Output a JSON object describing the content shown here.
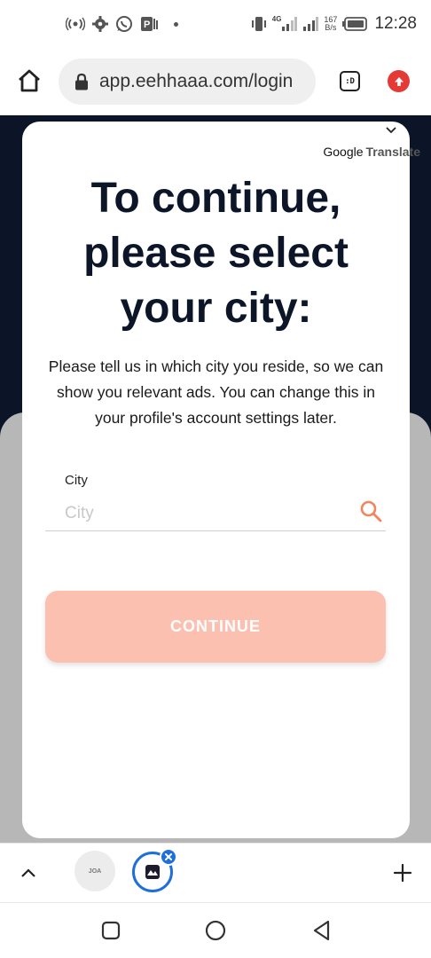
{
  "status_bar": {
    "net_speed_value": "167",
    "net_speed_unit": "B/s",
    "network_type": "4G",
    "time": "12:28"
  },
  "browser": {
    "url": "app.eehhaaa.com/login",
    "tabs_button_label": ":D",
    "update_color": "#e53935"
  },
  "translate": {
    "brand": "Google",
    "product": "Translate"
  },
  "modal": {
    "title_line1": "To continue,",
    "title_line2": "please select",
    "title_line3": "your city:",
    "description": "Please tell us in which city you reside, so we can show you relevant ads. You can change this in your profile's account settings later.",
    "city_label": "City",
    "city_placeholder": "City",
    "city_value": "",
    "continue_label": "CONTINUE",
    "accent_color": "#f4845f",
    "button_color": "#fcc0b0"
  },
  "tab_strip": {
    "tab1_label": "JOA"
  },
  "icons": {
    "status_left": [
      "radio-signal-icon",
      "settings-icon",
      "whatsapp-icon",
      "parking-app-icon"
    ],
    "status_right": [
      "vibrate-icon",
      "signal-4g-icon",
      "signal-icon",
      "battery-icon"
    ],
    "browser": [
      "home-icon",
      "lock-icon",
      "tabs-icon",
      "update-icon"
    ],
    "modal": [
      "chevron-down-icon",
      "search-icon"
    ],
    "tab_strip": [
      "chevron-up-icon",
      "close-icon",
      "new-tab-icon"
    ],
    "nav": [
      "recents-icon",
      "home-circle-icon",
      "back-icon"
    ]
  }
}
